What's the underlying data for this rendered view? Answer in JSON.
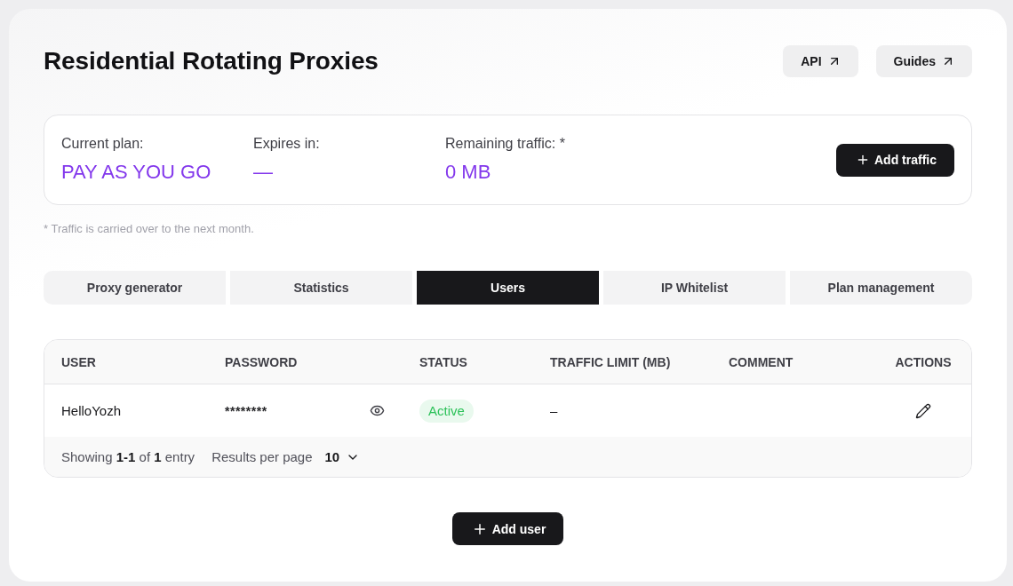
{
  "header": {
    "title": "Residential Rotating Proxies",
    "links": [
      {
        "label": "API"
      },
      {
        "label": "Guides"
      }
    ]
  },
  "plan": {
    "fields": [
      {
        "label": "Current plan:",
        "value": "PAY AS YOU GO"
      },
      {
        "label": "Expires in:",
        "value": "—"
      },
      {
        "label": "Remaining traffic: *",
        "value": "0 MB"
      }
    ],
    "button": "Add traffic"
  },
  "footnote": "* Traffic is carried over to the next month.",
  "tabs": [
    {
      "label": "Proxy generator",
      "selected": false
    },
    {
      "label": "Statistics",
      "selected": false
    },
    {
      "label": "Users",
      "selected": true
    },
    {
      "label": "IP Whitelist",
      "selected": false
    },
    {
      "label": "Plan management",
      "selected": false
    }
  ],
  "table": {
    "columns": [
      "USER",
      "PASSWORD",
      "STATUS",
      "TRAFFIC LIMIT (MB)",
      "COMMENT",
      "ACTIONS"
    ],
    "rows": [
      {
        "user": "HelloYozh",
        "password": "********",
        "status": "Active",
        "traffic_limit": "–"
      }
    ],
    "footer": {
      "summary": "Showing **1-1** of **1** entry",
      "page_size_label": "Results per page",
      "page_size": "10"
    }
  },
  "add_user_button": "Add user"
}
